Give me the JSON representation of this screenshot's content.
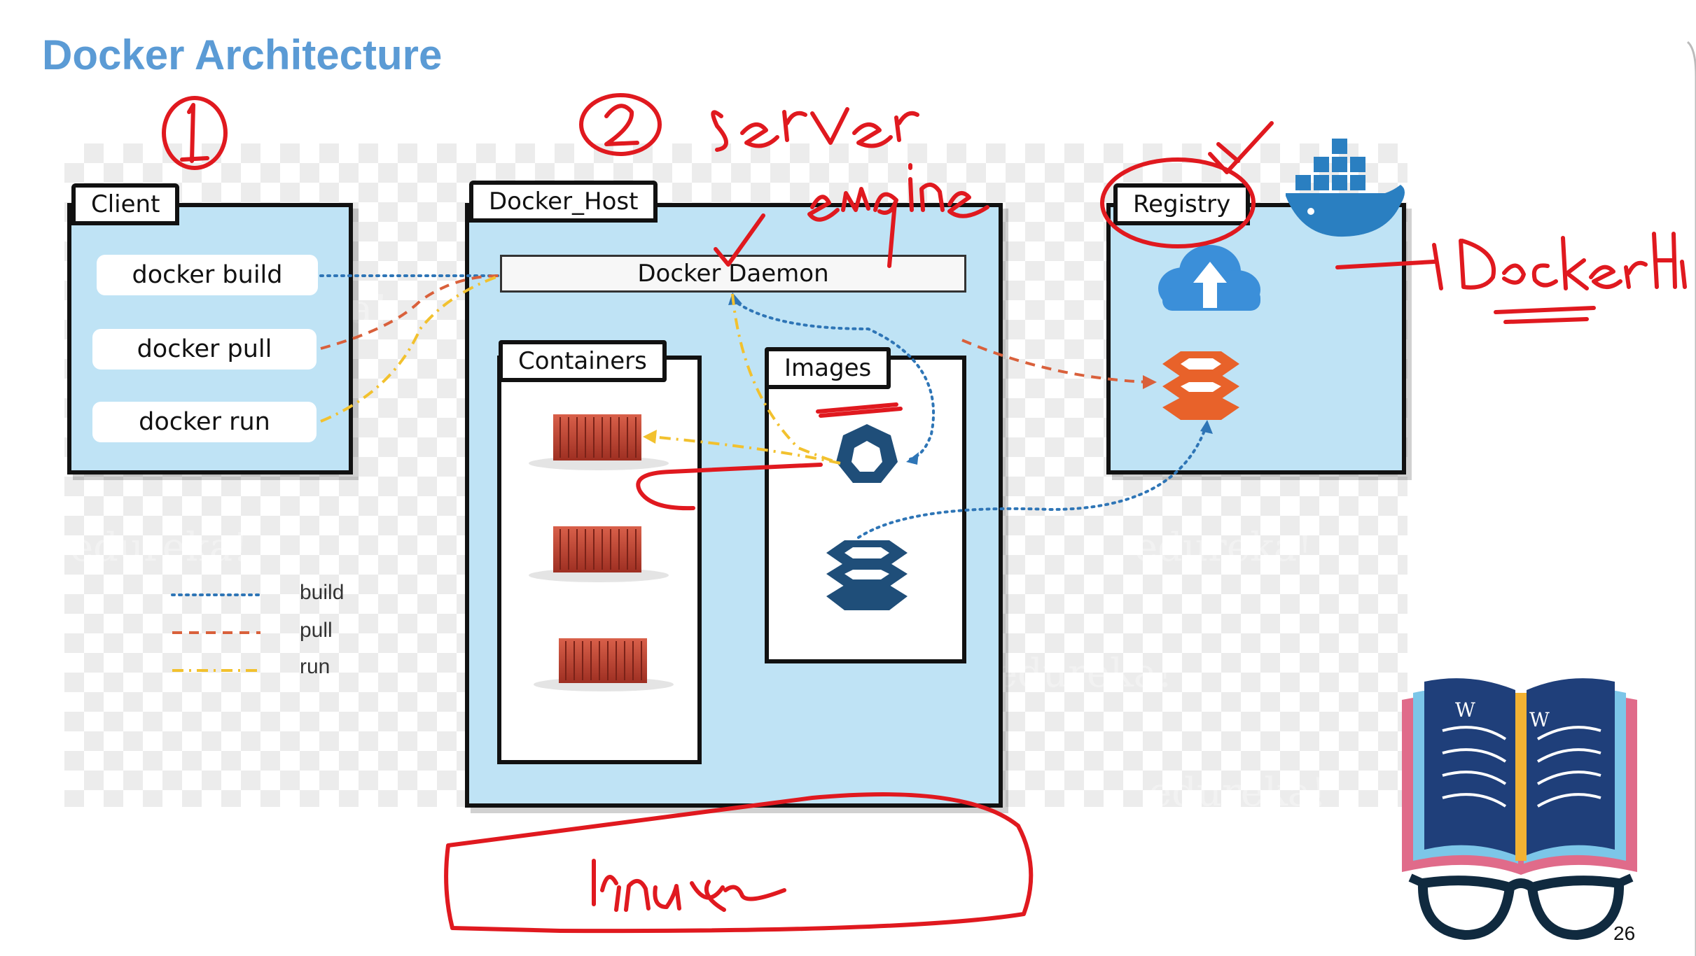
{
  "title": "Docker Architecture",
  "client": {
    "label": "Client",
    "commands": [
      "docker build",
      "docker pull",
      "docker run"
    ]
  },
  "host": {
    "label": "Docker_Host",
    "daemon": "Docker Daemon",
    "containers_label": "Containers",
    "images_label": "Images"
  },
  "registry": {
    "label": "Registry"
  },
  "legend": [
    {
      "label": "build",
      "style": "dotted",
      "color": "#2e75b6"
    },
    {
      "label": "pull",
      "style": "dashed",
      "color": "#d9603b"
    },
    {
      "label": "run",
      "style": "dash-dot",
      "color": "#f2c12e"
    }
  ],
  "watermark": "edureka!",
  "page_number": "26",
  "colors": {
    "title": "#5b9bd5",
    "panel": "#bfe3f5",
    "ink": "#e0191f",
    "image_icon": "#1f4e79",
    "registry_icon": "#e8622a"
  },
  "annotations": {
    "handwriting": [
      "1",
      "2",
      "Server",
      "engine",
      "DockerHub",
      "Linux"
    ]
  }
}
